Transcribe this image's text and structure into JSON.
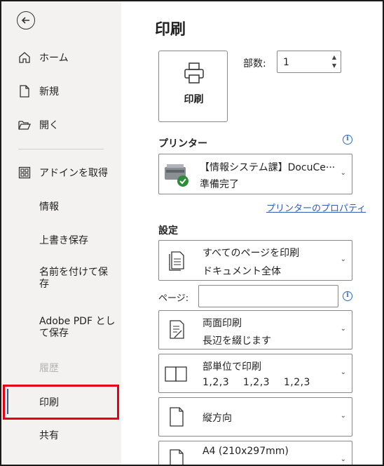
{
  "sidebar": {
    "items": [
      {
        "label": "ホーム",
        "icon": "home-icon"
      },
      {
        "label": "新規",
        "icon": "new-document-icon"
      },
      {
        "label": "開く",
        "icon": "folder-open-icon"
      },
      {
        "label": "アドインを取得",
        "icon": "addins-grid-icon"
      },
      {
        "label": "情報"
      },
      {
        "label": "上書き保存"
      },
      {
        "label": "名前を付けて保存"
      },
      {
        "label": "Adobe PDF として保存"
      },
      {
        "label": "履歴",
        "state": "disabled"
      },
      {
        "label": "印刷",
        "state": "selected"
      },
      {
        "label": "共有"
      }
    ]
  },
  "main": {
    "title": "印刷",
    "print_button_label": "印刷",
    "copies_label": "部数:",
    "copies_value": "1",
    "printer_header": "プリンター",
    "printer": {
      "name": "【情報システム課】DocuCe···",
      "status": "準備完了"
    },
    "printer_properties_link": "プリンターのプロパティ",
    "settings_header": "設定",
    "settings": [
      {
        "line1": "すべてのページを印刷",
        "line2": "ドキュメント全体",
        "icon": "pages-icon"
      },
      {
        "line1": "両面印刷",
        "line2": "長辺を綴じます",
        "icon": "duplex-icon"
      },
      {
        "line1": "部単位で印刷",
        "line2": "1,2,3    1,2,3    1,2,3",
        "icon": "collate-icon"
      },
      {
        "line1": "縦方向",
        "icon": "portrait-icon"
      },
      {
        "line1": "A4 (210x297mm)",
        "icon": "paper-size-icon"
      }
    ],
    "pages_label": "ページ:",
    "pages_value": ""
  },
  "colors": {
    "sidebar_bg": "#f3f2f1",
    "accent": "#2b579a",
    "highlight_border": "#e60012",
    "link": "#2b5fb5"
  }
}
